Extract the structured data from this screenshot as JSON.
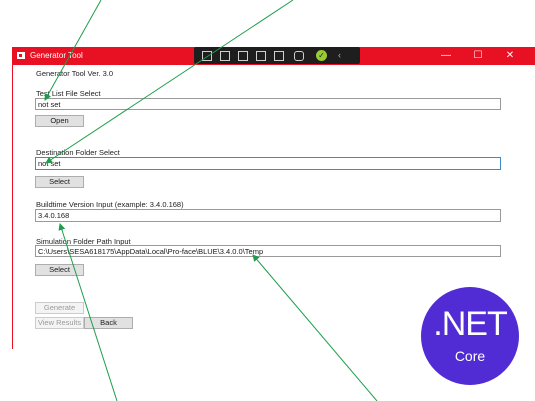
{
  "window": {
    "title": "Generator Tool",
    "version_label": "Generator Tool Ver. 3.0",
    "accent_color": "#e81123"
  },
  "window_controls": {
    "minimize": "—",
    "maximize": "☐",
    "close": "✕"
  },
  "debug_toolbar": {
    "icons": [
      "live-visual-tree-icon",
      "record-icon",
      "select-element-icon",
      "display-layout-adorners-icon",
      "track-focus-icon",
      "hot-reload-icon",
      "binding-failures-icon",
      "collapse-icon"
    ],
    "check_glyph": "✓",
    "collapse_glyph": "‹"
  },
  "form": {
    "test_list": {
      "label": "Test List File Select",
      "value": "not set",
      "button": "Open"
    },
    "destination": {
      "label": "Destination Folder Select",
      "value": "not set",
      "button": "Select"
    },
    "buildtime": {
      "label": "Buildtime Version Input (example: 3.4.0.168)",
      "value": "3.4.0.168"
    },
    "simulation": {
      "label": "Simulation Folder Path Input",
      "value": "C:\\Users\\SESA618175\\AppData\\Local\\Pro-face\\BLUE\\3.4.0.0\\Temp",
      "button": "Select"
    },
    "actions": {
      "generate": "Generate",
      "view_results": "View Results",
      "back": "Back"
    }
  },
  "badge": {
    "main": ".NET",
    "sub": "Core",
    "color": "#512bd4"
  },
  "annotation_color": "#1e9e4a"
}
